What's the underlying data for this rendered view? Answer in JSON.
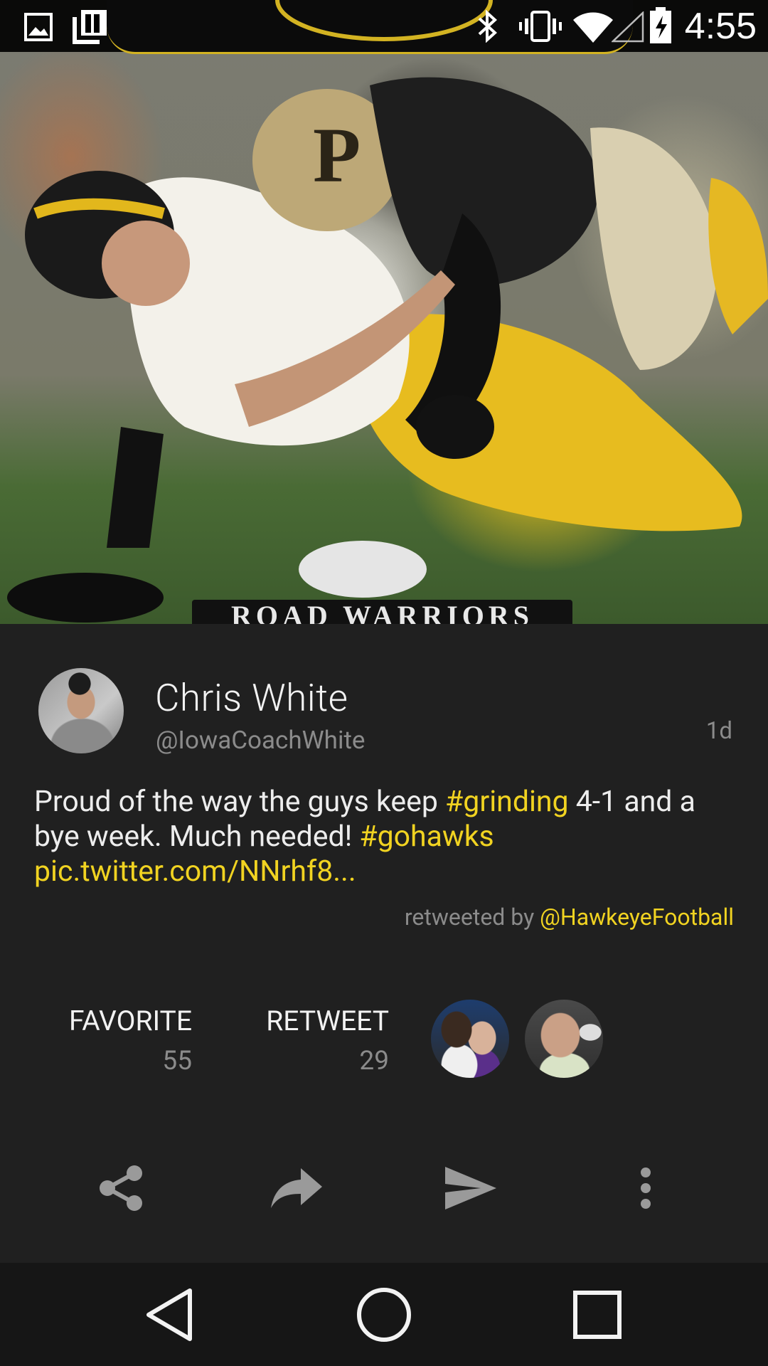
{
  "status_bar": {
    "time": "4:55",
    "icons": [
      "image-notification-icon",
      "clipboard-notification-icon",
      "bluetooth-icon",
      "vibrate-icon",
      "wifi-icon",
      "cell-signal-icon",
      "battery-charging-icon"
    ]
  },
  "hero": {
    "banner_text": "ROAD WARRIORS"
  },
  "tweet": {
    "author_name": "Chris White",
    "author_handle": "@IowaCoachWhite",
    "age": "1d",
    "text_parts": {
      "p1": "Proud of the way the guys keep ",
      "tag1": "#grinding",
      "p2": " 4-1 and a bye week. Much needed! ",
      "tag2": "#gohawks",
      "p3": " ",
      "link": "pic.twitter.com/NNrhf8...",
      "p4": ""
    },
    "retweeted_by_label": "retweeted by ",
    "retweeted_by_handle": "@HawkeyeFootball"
  },
  "stats": {
    "favorite_label": "FAVORITE",
    "favorite_count": "55",
    "retweet_label": "RETWEET",
    "retweet_count": "29"
  },
  "actions": [
    "share-icon",
    "forward-icon",
    "send-icon",
    "more-vert-icon"
  ],
  "nav": [
    "back-icon",
    "home-icon",
    "recents-icon"
  ],
  "colors": {
    "background": "#202020",
    "accent": "#f1d321",
    "secondary_text": "#8b8b8b",
    "nav_bar": "#161616"
  }
}
